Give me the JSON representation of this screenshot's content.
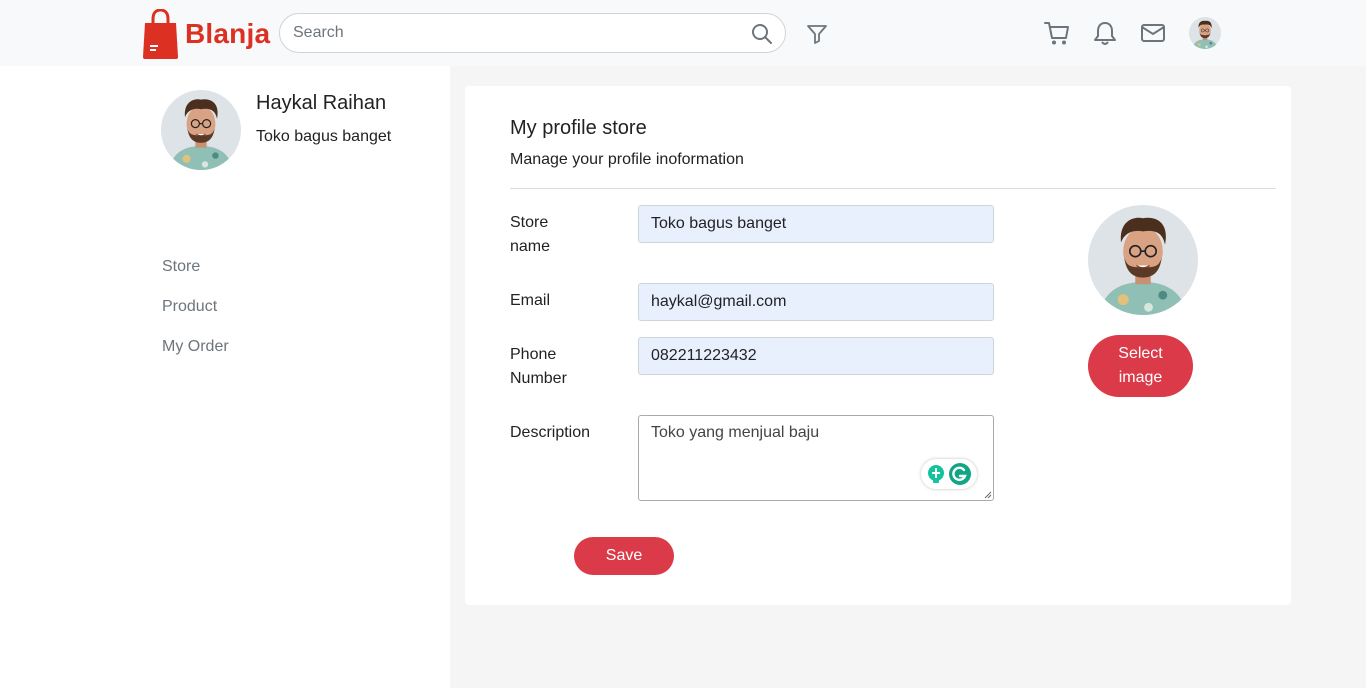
{
  "header": {
    "brand": "Blanja",
    "search_placeholder": "Search",
    "icons": [
      "shopping-bag-icon",
      "search-icon",
      "filter-icon",
      "cart-icon",
      "bell-icon",
      "mail-icon"
    ]
  },
  "sidebar": {
    "name": "Haykal Raihan",
    "store": "Toko bagus banget",
    "menu": [
      "Store",
      "Product",
      "My Order"
    ]
  },
  "form": {
    "title": "My profile store",
    "subtitle": "Manage your profile inoformation",
    "store_name_label_1": "Store",
    "store_name_label_2": "name",
    "store_name_value": "Toko bagus banget",
    "email_label": "Email",
    "email_value": "haykal@gmail.com",
    "phone_label_1": "Phone",
    "phone_label_2": "Number",
    "phone_value": "082211223432",
    "description_label": "Description",
    "description_value": "Toko yang menjual baju",
    "select_image_1": "Select",
    "select_image_2": "image",
    "save": "Save"
  },
  "colors": {
    "brand": "#db3022",
    "button": "#db3a49",
    "autofill": "#e8f0fe"
  }
}
